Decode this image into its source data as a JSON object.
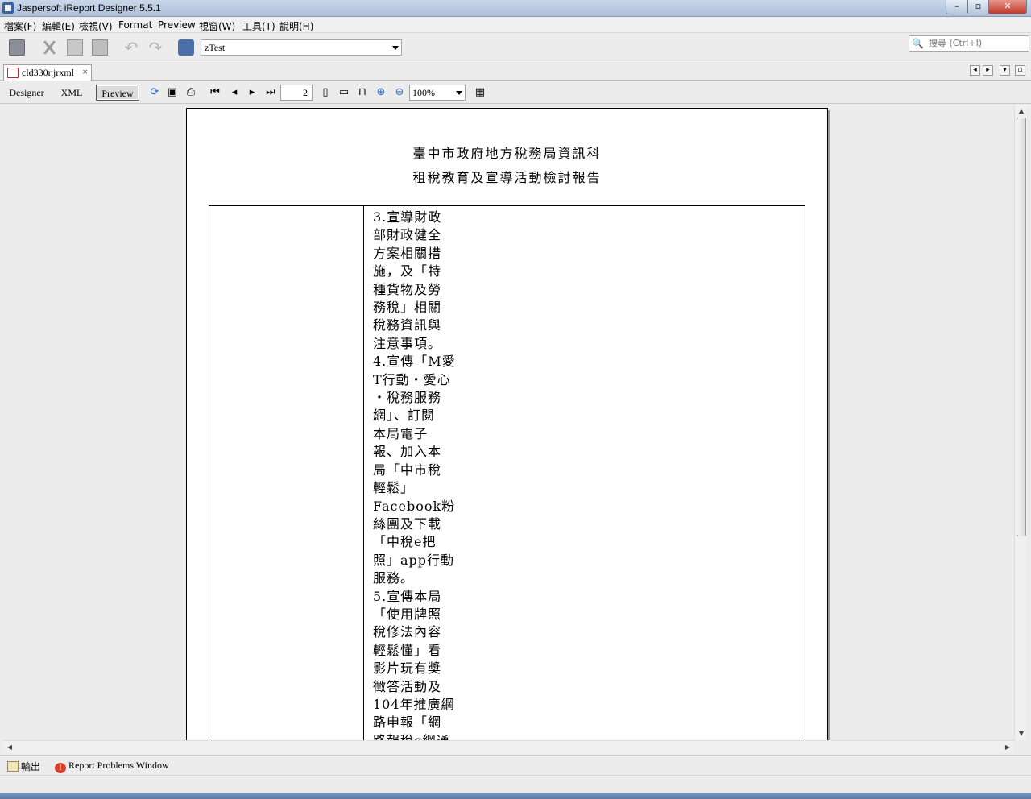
{
  "window": {
    "title": "Jaspersoft iReport Designer 5.5.1",
    "min": "–",
    "max": "▫",
    "close": "✕"
  },
  "menu": [
    "檔案(F)",
    "編輯(E)",
    "檢視(V)",
    "Format",
    "Preview",
    "視窗(W)",
    "工具(T)",
    "說明(H)"
  ],
  "toolbar": {
    "datasource": "zTest",
    "search_placeholder": "搜尋 (Ctrl+I)"
  },
  "doc_tab": {
    "name": "cld330r.jrxml",
    "close": "×"
  },
  "editor_tabs": {
    "designer": "Designer",
    "xml": "XML",
    "preview": "Preview"
  },
  "pager": {
    "page": "2",
    "zoom": "100%"
  },
  "report": {
    "title_line1": "臺中市政府地方稅務局資訊科",
    "title_line2": "租稅教育及宣導活動檢討報告",
    "cell_lines": [
      "3.宣導財政",
      "部財政健全",
      "方案相關措",
      "施，及「特",
      "種貨物及勞",
      "務稅」相關",
      "稅務資訊與",
      "注意事項。",
      "4.宣傳「M愛",
      "T行動・愛心",
      "・稅務服務",
      "網」、訂閱",
      "本局電子",
      "報、加入本",
      "局「中市稅",
      "輕鬆」",
      "Facebook粉",
      "絲團及下載",
      "「中稅e把",
      "照」app行動",
      "服務。",
      "5.宣傳本局",
      "「使用牌照",
      "稅修法內容",
      "輕鬆懂」看",
      "影片玩有獎",
      "徵答活動及",
      "104年推廣網",
      "路申報「網",
      "路報稅e網通"
    ]
  },
  "bottom_panels": {
    "output": "輸出",
    "problems": "Report Problems Window"
  }
}
